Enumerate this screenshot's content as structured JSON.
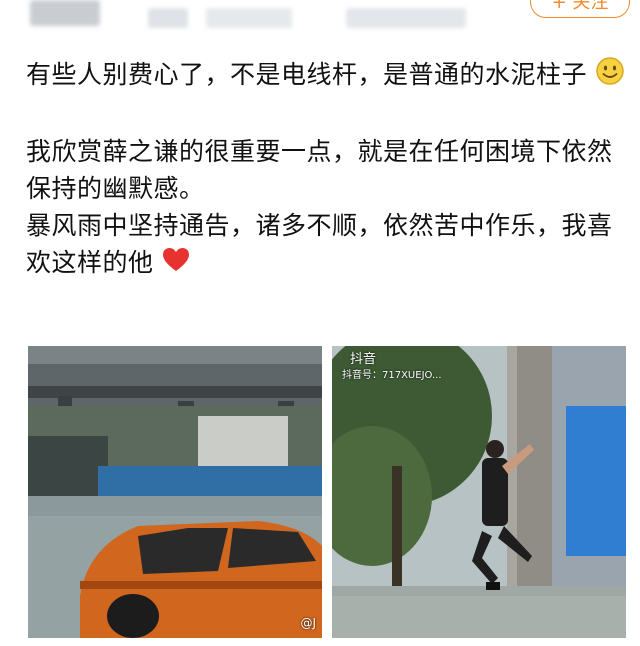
{
  "header": {
    "follow_label": "+ 关注"
  },
  "post": {
    "paragraphs": [
      "有些人别费心了，不是电线杆，是普通的水泥柱子",
      "我欣赏薛之谦的很重要一点，就是在任何困境下依然保持的幽默感。",
      "暴风雨中坚持通告，诸多不顺，依然苦中作乐，我喜欢这样的他"
    ],
    "emoji_1": "smile-emoji",
    "emoji_2": "red-heart-emoji"
  },
  "images": {
    "photo_left_watermark": "@J",
    "photo_right_app_label": "抖音",
    "photo_right_id_label": "抖音号：717XUEJO..."
  },
  "colors": {
    "accent": "#f08a2c",
    "text": "#111111",
    "heart": "#e8322f"
  }
}
